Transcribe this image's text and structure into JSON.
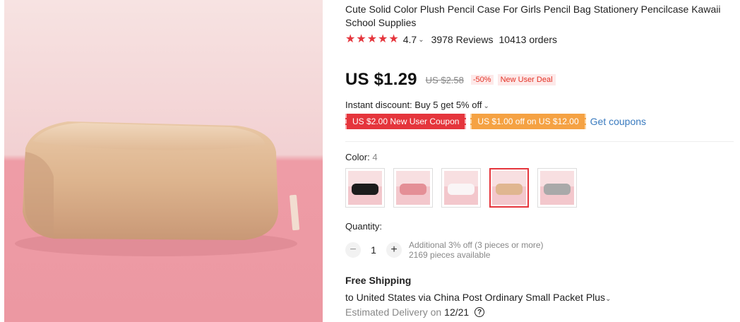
{
  "product": {
    "title": "Cute Solid Color Plush Pencil Case For Girls Pencil Bag Stationery Pencilcase Kawaii School Supplies",
    "rating": "4.7",
    "stars": 5,
    "reviews": "3978 Reviews",
    "orders": "10413 orders",
    "price": "US $1.29",
    "original_price": "US $2.58",
    "discount": "-50%",
    "deal_badge": "New User Deal",
    "instant_discount": "Instant discount: Buy 5 get 5% off",
    "coupons": [
      "US $2.00 New User Coupon",
      "US $1.00 off on US $12.00"
    ],
    "get_coupons": "Get coupons"
  },
  "color": {
    "label": "Color:",
    "value": "4",
    "swatches": [
      {
        "name": "black",
        "color": "#1c1c1c"
      },
      {
        "name": "pink",
        "color": "#e48f96"
      },
      {
        "name": "white",
        "color": "#f4eef0"
      },
      {
        "name": "beige",
        "color": "#e0b690"
      },
      {
        "name": "gray",
        "color": "#a9a9a9"
      }
    ],
    "selected_index": 3
  },
  "quantity": {
    "label": "Quantity:",
    "value": "1",
    "minus": "−",
    "plus": "+",
    "additional": "Additional 3% off (3 pieces or more)",
    "available": "2169 pieces available"
  },
  "shipping": {
    "title": "Free Shipping",
    "detail": "to United States via China Post Ordinary Small Packet Plus",
    "estimated_label": "Estimated Delivery on",
    "date": "12/21",
    "help": "?"
  },
  "icons": {
    "star": "★",
    "chevron": "⌄"
  },
  "colors": {
    "accent_red": "#e5353c",
    "coupon_orange": "#f5a243",
    "link_blue": "#3a7bbf"
  }
}
